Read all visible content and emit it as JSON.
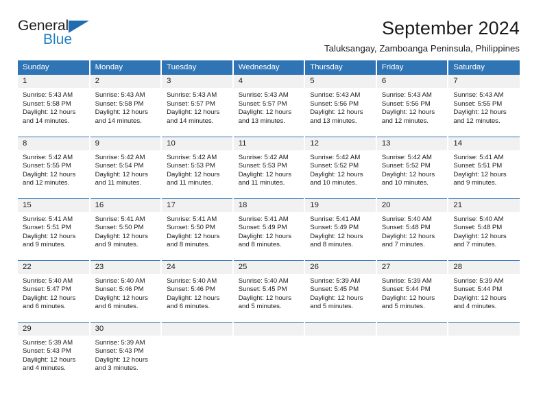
{
  "brand": {
    "name_part1": "General",
    "name_part2": "Blue",
    "triangle_icon": "triangle-icon",
    "accent_color": "#1f7fc4"
  },
  "header": {
    "title": "September 2024",
    "location": "Taluksangay, Zamboanga Peninsula, Philippines"
  },
  "colors": {
    "header_blue": "#2f74b5",
    "daynum_gray": "#f1f1f1",
    "text": "#1a1a1a"
  },
  "weekday_headers": [
    "Sunday",
    "Monday",
    "Tuesday",
    "Wednesday",
    "Thursday",
    "Friday",
    "Saturday"
  ],
  "weeks": [
    [
      {
        "day": "1",
        "sunrise": "Sunrise: 5:43 AM",
        "sunset": "Sunset: 5:58 PM",
        "daylight1": "Daylight: 12 hours",
        "daylight2": "and 14 minutes."
      },
      {
        "day": "2",
        "sunrise": "Sunrise: 5:43 AM",
        "sunset": "Sunset: 5:58 PM",
        "daylight1": "Daylight: 12 hours",
        "daylight2": "and 14 minutes."
      },
      {
        "day": "3",
        "sunrise": "Sunrise: 5:43 AM",
        "sunset": "Sunset: 5:57 PM",
        "daylight1": "Daylight: 12 hours",
        "daylight2": "and 14 minutes."
      },
      {
        "day": "4",
        "sunrise": "Sunrise: 5:43 AM",
        "sunset": "Sunset: 5:57 PM",
        "daylight1": "Daylight: 12 hours",
        "daylight2": "and 13 minutes."
      },
      {
        "day": "5",
        "sunrise": "Sunrise: 5:43 AM",
        "sunset": "Sunset: 5:56 PM",
        "daylight1": "Daylight: 12 hours",
        "daylight2": "and 13 minutes."
      },
      {
        "day": "6",
        "sunrise": "Sunrise: 5:43 AM",
        "sunset": "Sunset: 5:56 PM",
        "daylight1": "Daylight: 12 hours",
        "daylight2": "and 12 minutes."
      },
      {
        "day": "7",
        "sunrise": "Sunrise: 5:43 AM",
        "sunset": "Sunset: 5:55 PM",
        "daylight1": "Daylight: 12 hours",
        "daylight2": "and 12 minutes."
      }
    ],
    [
      {
        "day": "8",
        "sunrise": "Sunrise: 5:42 AM",
        "sunset": "Sunset: 5:55 PM",
        "daylight1": "Daylight: 12 hours",
        "daylight2": "and 12 minutes."
      },
      {
        "day": "9",
        "sunrise": "Sunrise: 5:42 AM",
        "sunset": "Sunset: 5:54 PM",
        "daylight1": "Daylight: 12 hours",
        "daylight2": "and 11 minutes."
      },
      {
        "day": "10",
        "sunrise": "Sunrise: 5:42 AM",
        "sunset": "Sunset: 5:53 PM",
        "daylight1": "Daylight: 12 hours",
        "daylight2": "and 11 minutes."
      },
      {
        "day": "11",
        "sunrise": "Sunrise: 5:42 AM",
        "sunset": "Sunset: 5:53 PM",
        "daylight1": "Daylight: 12 hours",
        "daylight2": "and 11 minutes."
      },
      {
        "day": "12",
        "sunrise": "Sunrise: 5:42 AM",
        "sunset": "Sunset: 5:52 PM",
        "daylight1": "Daylight: 12 hours",
        "daylight2": "and 10 minutes."
      },
      {
        "day": "13",
        "sunrise": "Sunrise: 5:42 AM",
        "sunset": "Sunset: 5:52 PM",
        "daylight1": "Daylight: 12 hours",
        "daylight2": "and 10 minutes."
      },
      {
        "day": "14",
        "sunrise": "Sunrise: 5:41 AM",
        "sunset": "Sunset: 5:51 PM",
        "daylight1": "Daylight: 12 hours",
        "daylight2": "and 9 minutes."
      }
    ],
    [
      {
        "day": "15",
        "sunrise": "Sunrise: 5:41 AM",
        "sunset": "Sunset: 5:51 PM",
        "daylight1": "Daylight: 12 hours",
        "daylight2": "and 9 minutes."
      },
      {
        "day": "16",
        "sunrise": "Sunrise: 5:41 AM",
        "sunset": "Sunset: 5:50 PM",
        "daylight1": "Daylight: 12 hours",
        "daylight2": "and 9 minutes."
      },
      {
        "day": "17",
        "sunrise": "Sunrise: 5:41 AM",
        "sunset": "Sunset: 5:50 PM",
        "daylight1": "Daylight: 12 hours",
        "daylight2": "and 8 minutes."
      },
      {
        "day": "18",
        "sunrise": "Sunrise: 5:41 AM",
        "sunset": "Sunset: 5:49 PM",
        "daylight1": "Daylight: 12 hours",
        "daylight2": "and 8 minutes."
      },
      {
        "day": "19",
        "sunrise": "Sunrise: 5:41 AM",
        "sunset": "Sunset: 5:49 PM",
        "daylight1": "Daylight: 12 hours",
        "daylight2": "and 8 minutes."
      },
      {
        "day": "20",
        "sunrise": "Sunrise: 5:40 AM",
        "sunset": "Sunset: 5:48 PM",
        "daylight1": "Daylight: 12 hours",
        "daylight2": "and 7 minutes."
      },
      {
        "day": "21",
        "sunrise": "Sunrise: 5:40 AM",
        "sunset": "Sunset: 5:48 PM",
        "daylight1": "Daylight: 12 hours",
        "daylight2": "and 7 minutes."
      }
    ],
    [
      {
        "day": "22",
        "sunrise": "Sunrise: 5:40 AM",
        "sunset": "Sunset: 5:47 PM",
        "daylight1": "Daylight: 12 hours",
        "daylight2": "and 6 minutes."
      },
      {
        "day": "23",
        "sunrise": "Sunrise: 5:40 AM",
        "sunset": "Sunset: 5:46 PM",
        "daylight1": "Daylight: 12 hours",
        "daylight2": "and 6 minutes."
      },
      {
        "day": "24",
        "sunrise": "Sunrise: 5:40 AM",
        "sunset": "Sunset: 5:46 PM",
        "daylight1": "Daylight: 12 hours",
        "daylight2": "and 6 minutes."
      },
      {
        "day": "25",
        "sunrise": "Sunrise: 5:40 AM",
        "sunset": "Sunset: 5:45 PM",
        "daylight1": "Daylight: 12 hours",
        "daylight2": "and 5 minutes."
      },
      {
        "day": "26",
        "sunrise": "Sunrise: 5:39 AM",
        "sunset": "Sunset: 5:45 PM",
        "daylight1": "Daylight: 12 hours",
        "daylight2": "and 5 minutes."
      },
      {
        "day": "27",
        "sunrise": "Sunrise: 5:39 AM",
        "sunset": "Sunset: 5:44 PM",
        "daylight1": "Daylight: 12 hours",
        "daylight2": "and 5 minutes."
      },
      {
        "day": "28",
        "sunrise": "Sunrise: 5:39 AM",
        "sunset": "Sunset: 5:44 PM",
        "daylight1": "Daylight: 12 hours",
        "daylight2": "and 4 minutes."
      }
    ],
    [
      {
        "day": "29",
        "sunrise": "Sunrise: 5:39 AM",
        "sunset": "Sunset: 5:43 PM",
        "daylight1": "Daylight: 12 hours",
        "daylight2": "and 4 minutes."
      },
      {
        "day": "30",
        "sunrise": "Sunrise: 5:39 AM",
        "sunset": "Sunset: 5:43 PM",
        "daylight1": "Daylight: 12 hours",
        "daylight2": "and 3 minutes."
      },
      {
        "day": "",
        "sunrise": "",
        "sunset": "",
        "daylight1": "",
        "daylight2": ""
      },
      {
        "day": "",
        "sunrise": "",
        "sunset": "",
        "daylight1": "",
        "daylight2": ""
      },
      {
        "day": "",
        "sunrise": "",
        "sunset": "",
        "daylight1": "",
        "daylight2": ""
      },
      {
        "day": "",
        "sunrise": "",
        "sunset": "",
        "daylight1": "",
        "daylight2": ""
      },
      {
        "day": "",
        "sunrise": "",
        "sunset": "",
        "daylight1": "",
        "daylight2": ""
      }
    ]
  ]
}
